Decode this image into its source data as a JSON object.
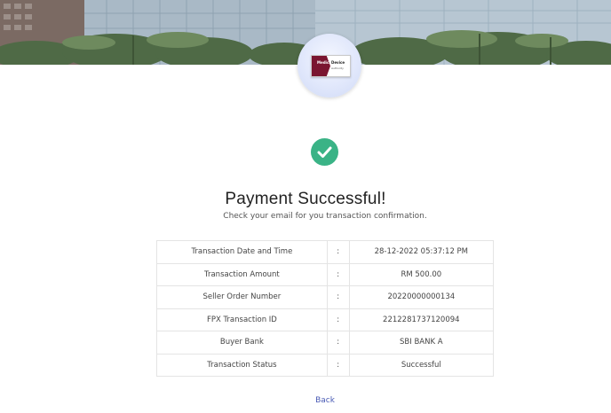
{
  "logo": {
    "line1": "Medical",
    "line2": "Device",
    "line3": "Authority"
  },
  "status": {
    "icon": "check-circle-icon",
    "title": "Payment Successful!",
    "subtitle": "Check your email for you transaction confirmation."
  },
  "transaction": {
    "separator": ":",
    "rows": [
      {
        "label": "Transaction Date and Time",
        "value": "28-12-2022 05:37:12 PM"
      },
      {
        "label": "Transaction Amount",
        "value": "RM 500.00"
      },
      {
        "label": "Seller Order Number",
        "value": "20220000000134"
      },
      {
        "label": "FPX Transaction ID",
        "value": "2212281737120094"
      },
      {
        "label": "Buyer Bank",
        "value": "SBI BANK A"
      },
      {
        "label": "Transaction Status",
        "value": "Successful"
      }
    ]
  },
  "actions": {
    "back_label": "Back"
  },
  "colors": {
    "success": "#3ab386",
    "link": "#4a5bb5",
    "brand": "#7a1530"
  }
}
